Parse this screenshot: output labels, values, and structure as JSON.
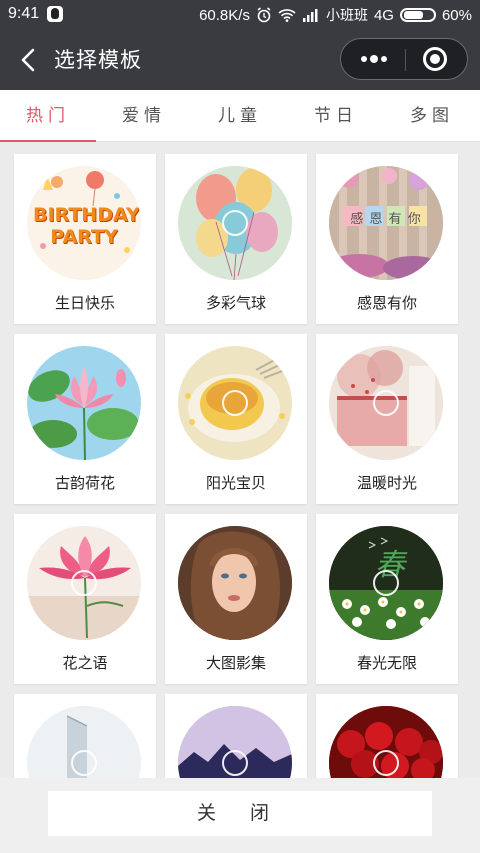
{
  "status_bar": {
    "time": "9:41",
    "network_speed": "60.8K/s",
    "carrier": "小班班",
    "network_type": "4G",
    "battery": "60%"
  },
  "nav": {
    "title": "选择模板"
  },
  "tabs": [
    {
      "label": "热门",
      "active": true
    },
    {
      "label": "爱情",
      "active": false
    },
    {
      "label": "儿童",
      "active": false
    },
    {
      "label": "节日",
      "active": false
    },
    {
      "label": "多图",
      "active": false
    }
  ],
  "templates": [
    {
      "label": "生日快乐",
      "thumb_text": "BIRTHDAY PARTY"
    },
    {
      "label": "多彩气球"
    },
    {
      "label": "感恩有你",
      "thumb_text": "感 恩 有 你"
    },
    {
      "label": "古韵荷花"
    },
    {
      "label": "阳光宝贝"
    },
    {
      "label": "温暖时光"
    },
    {
      "label": "花之语"
    },
    {
      "label": "大图影集"
    },
    {
      "label": "春光无限",
      "thumb_text": "春"
    },
    {
      "label": ""
    },
    {
      "label": ""
    },
    {
      "label": ""
    }
  ],
  "footer": {
    "close_label": "关 闭"
  },
  "colors": {
    "accent": "#e0566a",
    "nav_bg": "#3a3b40"
  }
}
